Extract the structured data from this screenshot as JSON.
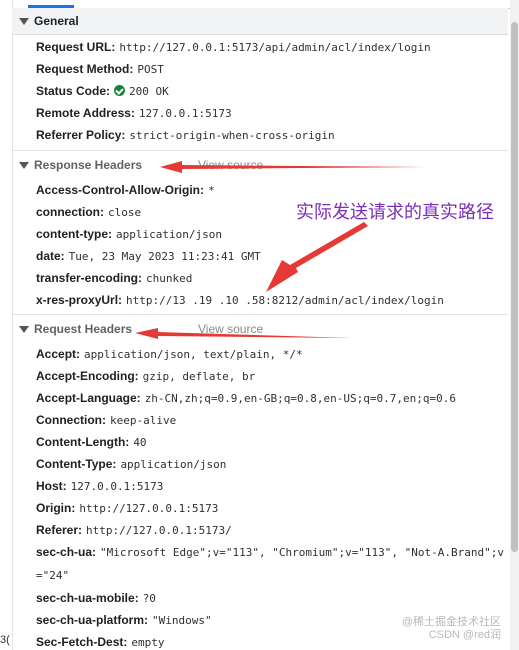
{
  "general": {
    "title": "General",
    "rows": [
      {
        "key": "Request URL:",
        "value": "http://127.0.0.1:5173/api/admin/acl/index/login"
      },
      {
        "key": "Request Method:",
        "value": "POST"
      },
      {
        "key": "Status Code:",
        "value": "200 OK"
      },
      {
        "key": "Remote Address:",
        "value": "127.0.0.1:5173"
      },
      {
        "key": "Referrer Policy:",
        "value": "strict-origin-when-cross-origin"
      }
    ]
  },
  "response_headers": {
    "title": "Response Headers",
    "view_source": "View source",
    "rows": [
      {
        "key": "Access-Control-Allow-Origin:",
        "value": "*"
      },
      {
        "key": "connection:",
        "value": "close"
      },
      {
        "key": "content-type:",
        "value": "application/json"
      },
      {
        "key": "date:",
        "value": "Tue, 23 May 2023 11:23:41 GMT"
      },
      {
        "key": "transfer-encoding:",
        "value": "chunked"
      },
      {
        "key": "x-res-proxyUrl:",
        "value": "http://13 .19 .10 .58:8212/admin/acl/index/login"
      }
    ]
  },
  "request_headers": {
    "title": "Request Headers",
    "view_source": "View source",
    "rows": [
      {
        "key": "Accept:",
        "value": "application/json, text/plain, */*"
      },
      {
        "key": "Accept-Encoding:",
        "value": "gzip, deflate, br"
      },
      {
        "key": "Accept-Language:",
        "value": "zh-CN,zh;q=0.9,en-GB;q=0.8,en-US;q=0.7,en;q=0.6"
      },
      {
        "key": "Connection:",
        "value": "keep-alive"
      },
      {
        "key": "Content-Length:",
        "value": "40"
      },
      {
        "key": "Content-Type:",
        "value": "application/json"
      },
      {
        "key": "Host:",
        "value": "127.0.0.1:5173"
      },
      {
        "key": "Origin:",
        "value": "http://127.0.0.1:5173"
      },
      {
        "key": "Referer:",
        "value": "http://127.0.0.1:5173/"
      },
      {
        "key": "sec-ch-ua:",
        "value": "\"Microsoft Edge\";v=\"113\", \"Chromium\";v=\"113\", \"Not-A.Brand\";v=\"24\""
      },
      {
        "key": "sec-ch-ua-mobile:",
        "value": "?0"
      },
      {
        "key": "sec-ch-ua-platform:",
        "value": "\"Windows\""
      },
      {
        "key": "Sec-Fetch-Dest:",
        "value": "empty"
      }
    ]
  },
  "annotation": "实际发送请求的真实路径",
  "watermark": {
    "line1": "@稀土掘金技术社区",
    "line2": "CSDN @red润"
  },
  "left_edge_text": "3(",
  "colors": {
    "arrow": "#e53935",
    "annotation": "#7b2fb5",
    "status_ok": "#188038"
  }
}
